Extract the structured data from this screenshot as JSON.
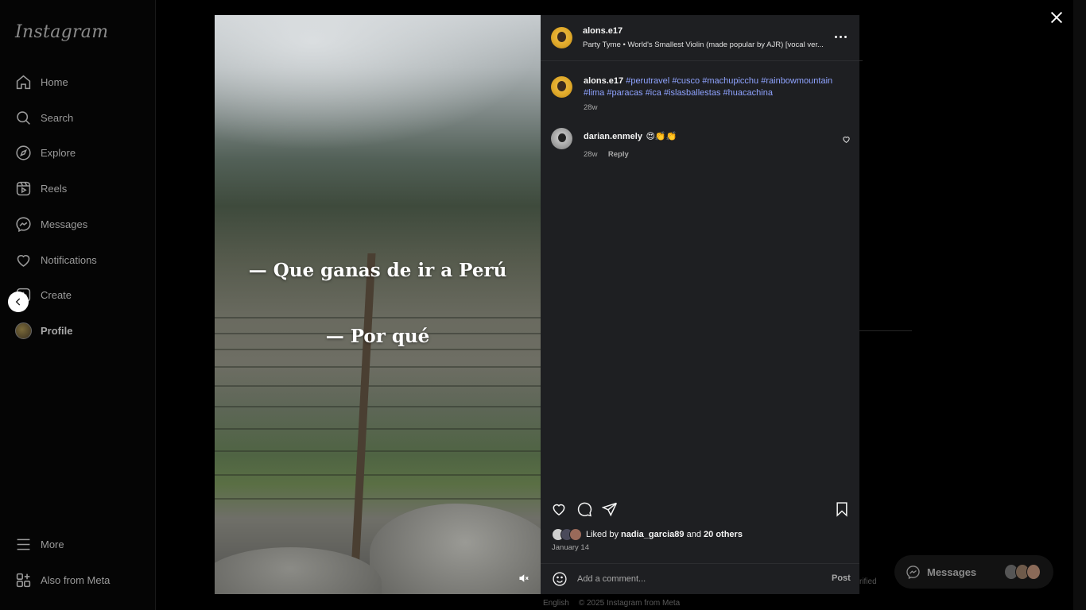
{
  "sidebar": {
    "logo": "Instagram",
    "items": [
      {
        "label": "Home",
        "icon": "home-icon"
      },
      {
        "label": "Search",
        "icon": "search-icon"
      },
      {
        "label": "Explore",
        "icon": "compass-icon"
      },
      {
        "label": "Reels",
        "icon": "reels-icon"
      },
      {
        "label": "Messages",
        "icon": "messenger-icon"
      },
      {
        "label": "Notifications",
        "icon": "heart-icon"
      },
      {
        "label": "Create",
        "icon": "plus-square-icon"
      },
      {
        "label": "Profile",
        "icon": "avatar"
      }
    ],
    "more_label": "More",
    "meta_label": "Also from Meta"
  },
  "background": {
    "verified_fragment": "rified",
    "footer": {
      "language": "English",
      "copyright": "© 2025 Instagram from Meta"
    },
    "messages_label": "Messages"
  },
  "post": {
    "media": {
      "line1": "— Que ganas de ir a Perú",
      "line2": "— Por qué",
      "muted": true
    },
    "header": {
      "username": "alons.e17",
      "audio": "Party Tyme • World's Smallest Violin (made popular by AJR) [vocal ver..."
    },
    "caption": {
      "username": "alons.e17",
      "hashtags": [
        "#perutravel",
        "#cusco",
        "#machupicchu",
        "#rainbowmountain",
        "#lima",
        "#paracas",
        "#ica",
        "#islasballestas",
        "#huacachina"
      ],
      "time": "28w"
    },
    "comments": [
      {
        "username": "darian.enmely",
        "text": "😍👏👏",
        "time": "28w",
        "reply_label": "Reply"
      }
    ],
    "likes": {
      "prefix": "Liked by",
      "user": "nadia_garcia89",
      "connector": "and",
      "others": "20 others"
    },
    "date": "January 14",
    "comment_box": {
      "placeholder": "Add a comment...",
      "post_label": "Post"
    }
  }
}
